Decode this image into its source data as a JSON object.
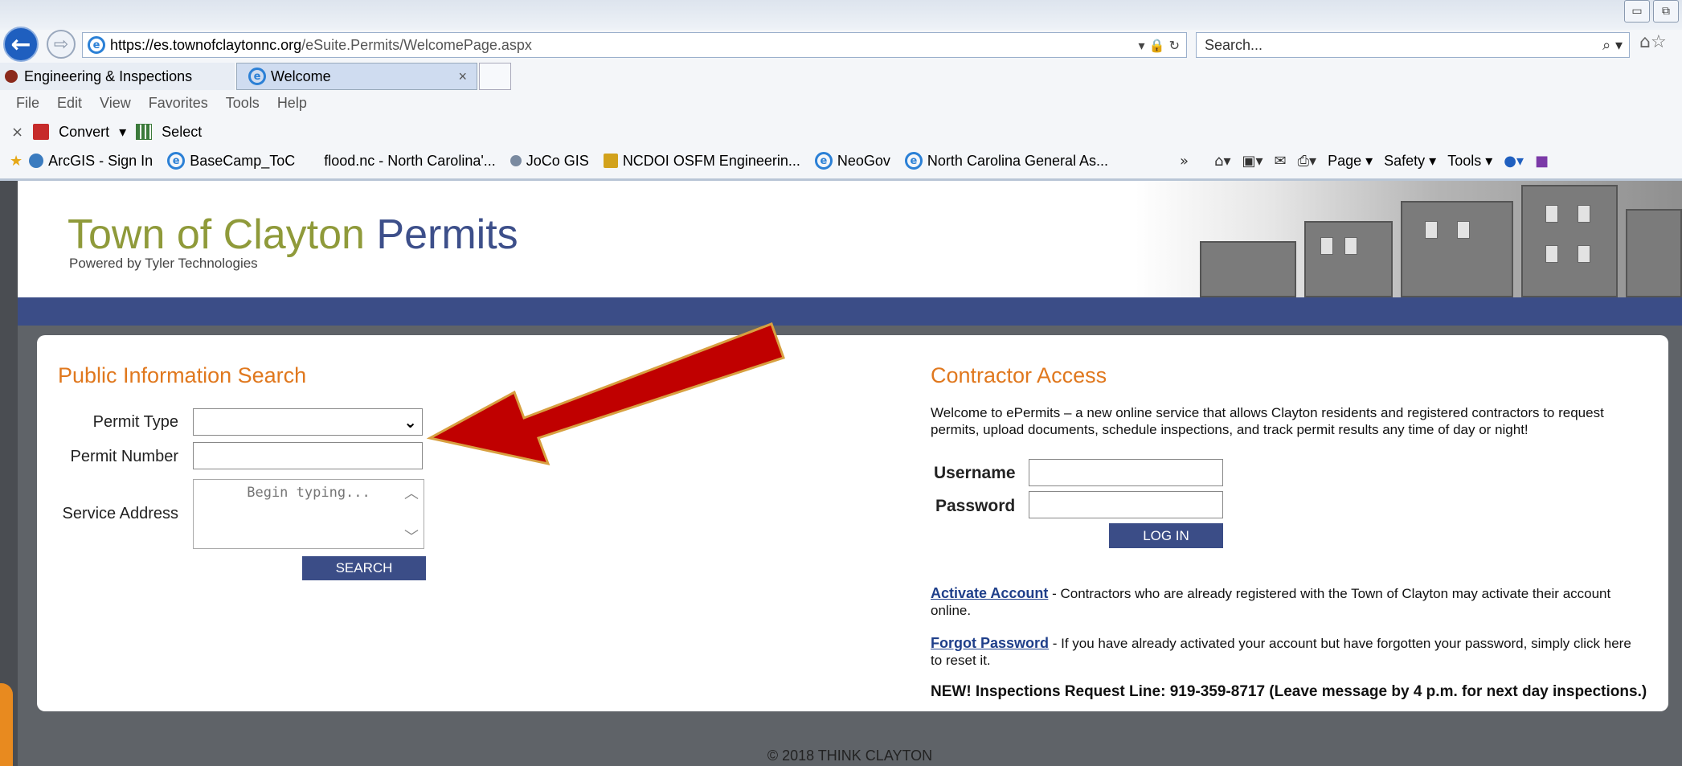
{
  "browser": {
    "url_scheme": "https://es.",
    "url_host": "townofclaytonnc.org",
    "url_path": "/eSuite.Permits/WelcomePage.aspx",
    "addr_controls": "▾ 🔒 ↻",
    "search_placeholder": "Search...",
    "search_icon": "⌕ ▾",
    "tabs": [
      {
        "label": "Engineering & Inspections"
      },
      {
        "label": "Welcome",
        "close": "×"
      }
    ],
    "menu": [
      "File",
      "Edit",
      "View",
      "Favorites",
      "Tools",
      "Help"
    ],
    "cmdbar": {
      "close": "×",
      "convert": "Convert",
      "convert_arrow": "▾",
      "select": "Select"
    },
    "favorites": [
      {
        "label": "ArcGIS - Sign In"
      },
      {
        "label": "BaseCamp_ToC"
      },
      {
        "label": "flood.nc - North Carolina'..."
      },
      {
        "label": "JoCo GIS"
      },
      {
        "label": "NCDOI OSFM  Engineerin..."
      },
      {
        "label": "NeoGov"
      },
      {
        "label": "North Carolina General As..."
      }
    ],
    "fav_more": "»",
    "cmd_right": {
      "page": "Page ▾",
      "safety": "Safety ▾",
      "tools": "Tools ▾"
    }
  },
  "site": {
    "title_part1": "Town of Clayton",
    "title_part2": " Permits",
    "powered_by": "Powered by Tyler Technologies"
  },
  "public_search": {
    "heading": "Public Information Search",
    "permit_type_label": "Permit Type",
    "permit_number_label": "Permit Number",
    "service_address_label": "Service Address",
    "service_address_placeholder": "Begin typing...",
    "search_button": "SEARCH"
  },
  "contractor": {
    "heading": "Contractor Access",
    "welcome": "Welcome to ePermits – a new online service that allows Clayton residents and registered contractors to request permits, upload documents, schedule inspections, and track permit results any time of day or night!",
    "username_label": "Username",
    "password_label": "Password",
    "login_button": "LOG IN",
    "activate_link": "Activate Account",
    "activate_text": " - Contractors who are already registered with the Town of Clayton may activate their account online.",
    "forgot_link": "Forgot Password",
    "forgot_text": " - If you have already activated your account but have forgotten your password, simply click here to reset it.",
    "new_line": "NEW! Inspections Request Line: 919-359-8717 (Leave message by 4 p.m. for next day inspections.)"
  },
  "footer": "© 2018 THINK CLAYTON",
  "colors": {
    "accent_orange": "#e0781e",
    "brand_blue": "#3b4d87",
    "title_olive": "#8f9a3a",
    "arrow_red": "#c00000"
  }
}
